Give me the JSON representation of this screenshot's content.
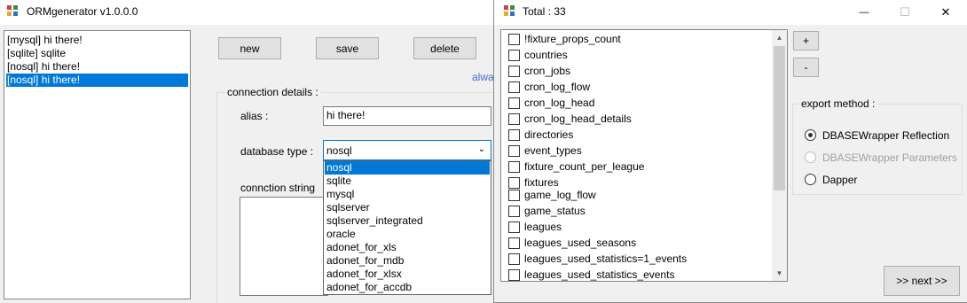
{
  "left_window": {
    "title": "ORMgenerator v1.0.0.0",
    "icon": "app-icon",
    "configs_list": [
      {
        "label": "[mysql] hi there!",
        "selected": false
      },
      {
        "label": "[sqlite] sqlite",
        "selected": false
      },
      {
        "label": "[nosql] hi there!",
        "selected": false
      },
      {
        "label": "[nosql] hi there!",
        "selected": true
      }
    ],
    "buttons": {
      "new": "new",
      "save": "save",
      "delete": "delete"
    },
    "partial_link": "alwa",
    "connection_details": {
      "group_title": "connection details :",
      "alias_label": "alias :",
      "alias_value": "hi there!",
      "db_type_label": "database type :",
      "db_type_value": "nosql",
      "db_type_options": [
        {
          "label": "nosql",
          "selected": true
        },
        {
          "label": "sqlite",
          "selected": false
        },
        {
          "label": "mysql",
          "selected": false
        },
        {
          "label": "sqlserver",
          "selected": false
        },
        {
          "label": "sqlserver_integrated",
          "selected": false
        },
        {
          "label": "oracle",
          "selected": false
        },
        {
          "label": "adonet_for_xls",
          "selected": false
        },
        {
          "label": "adonet_for_mdb",
          "selected": false
        },
        {
          "label": "adonet_for_xlsx",
          "selected": false
        },
        {
          "label": "adonet_for_accdb",
          "selected": false
        }
      ],
      "conn_string_label": "connction string",
      "conn_string_value": ""
    }
  },
  "right_window": {
    "title": "Total : 33",
    "icon": "app-icon",
    "caption_buttons": {
      "minimize": "—",
      "maximize": "☐",
      "close": "✕"
    },
    "tables": [
      {
        "label": "!fixture_props_count",
        "checked": false
      },
      {
        "label": "countries",
        "checked": false
      },
      {
        "label": "cron_jobs",
        "checked": false
      },
      {
        "label": "cron_log_flow",
        "checked": false
      },
      {
        "label": "cron_log_head",
        "checked": false
      },
      {
        "label": "cron_log_head_details",
        "checked": false
      },
      {
        "label": "directories",
        "checked": false
      },
      {
        "label": "event_types",
        "checked": false
      },
      {
        "label": "fixture_count_per_league",
        "checked": false
      },
      {
        "label": "fixtures",
        "checked": false
      },
      {
        "label": "game_log_flow",
        "checked": false
      },
      {
        "label": "game_status",
        "checked": false
      },
      {
        "label": "leagues",
        "checked": false
      },
      {
        "label": "leagues_used_seasons",
        "checked": false
      },
      {
        "label": "leagues_used_statistics=1_events",
        "checked": false
      },
      {
        "label": "leagues_used_statistics_events",
        "checked": false
      }
    ],
    "plus_button": "+",
    "minus_button": "-",
    "export_method": {
      "group_title": "export method :",
      "options": [
        {
          "label": "DBASEWrapper Reflection",
          "checked": true,
          "enabled": true
        },
        {
          "label": "DBASEWrapper Parameters",
          "checked": false,
          "enabled": false
        },
        {
          "label": "Dapper",
          "checked": false,
          "enabled": true
        }
      ]
    },
    "next_button": ">> next >>"
  },
  "colors": {
    "selection": "#0078d7",
    "window_bg": "#f0f0f0",
    "link": "#0066cc"
  }
}
